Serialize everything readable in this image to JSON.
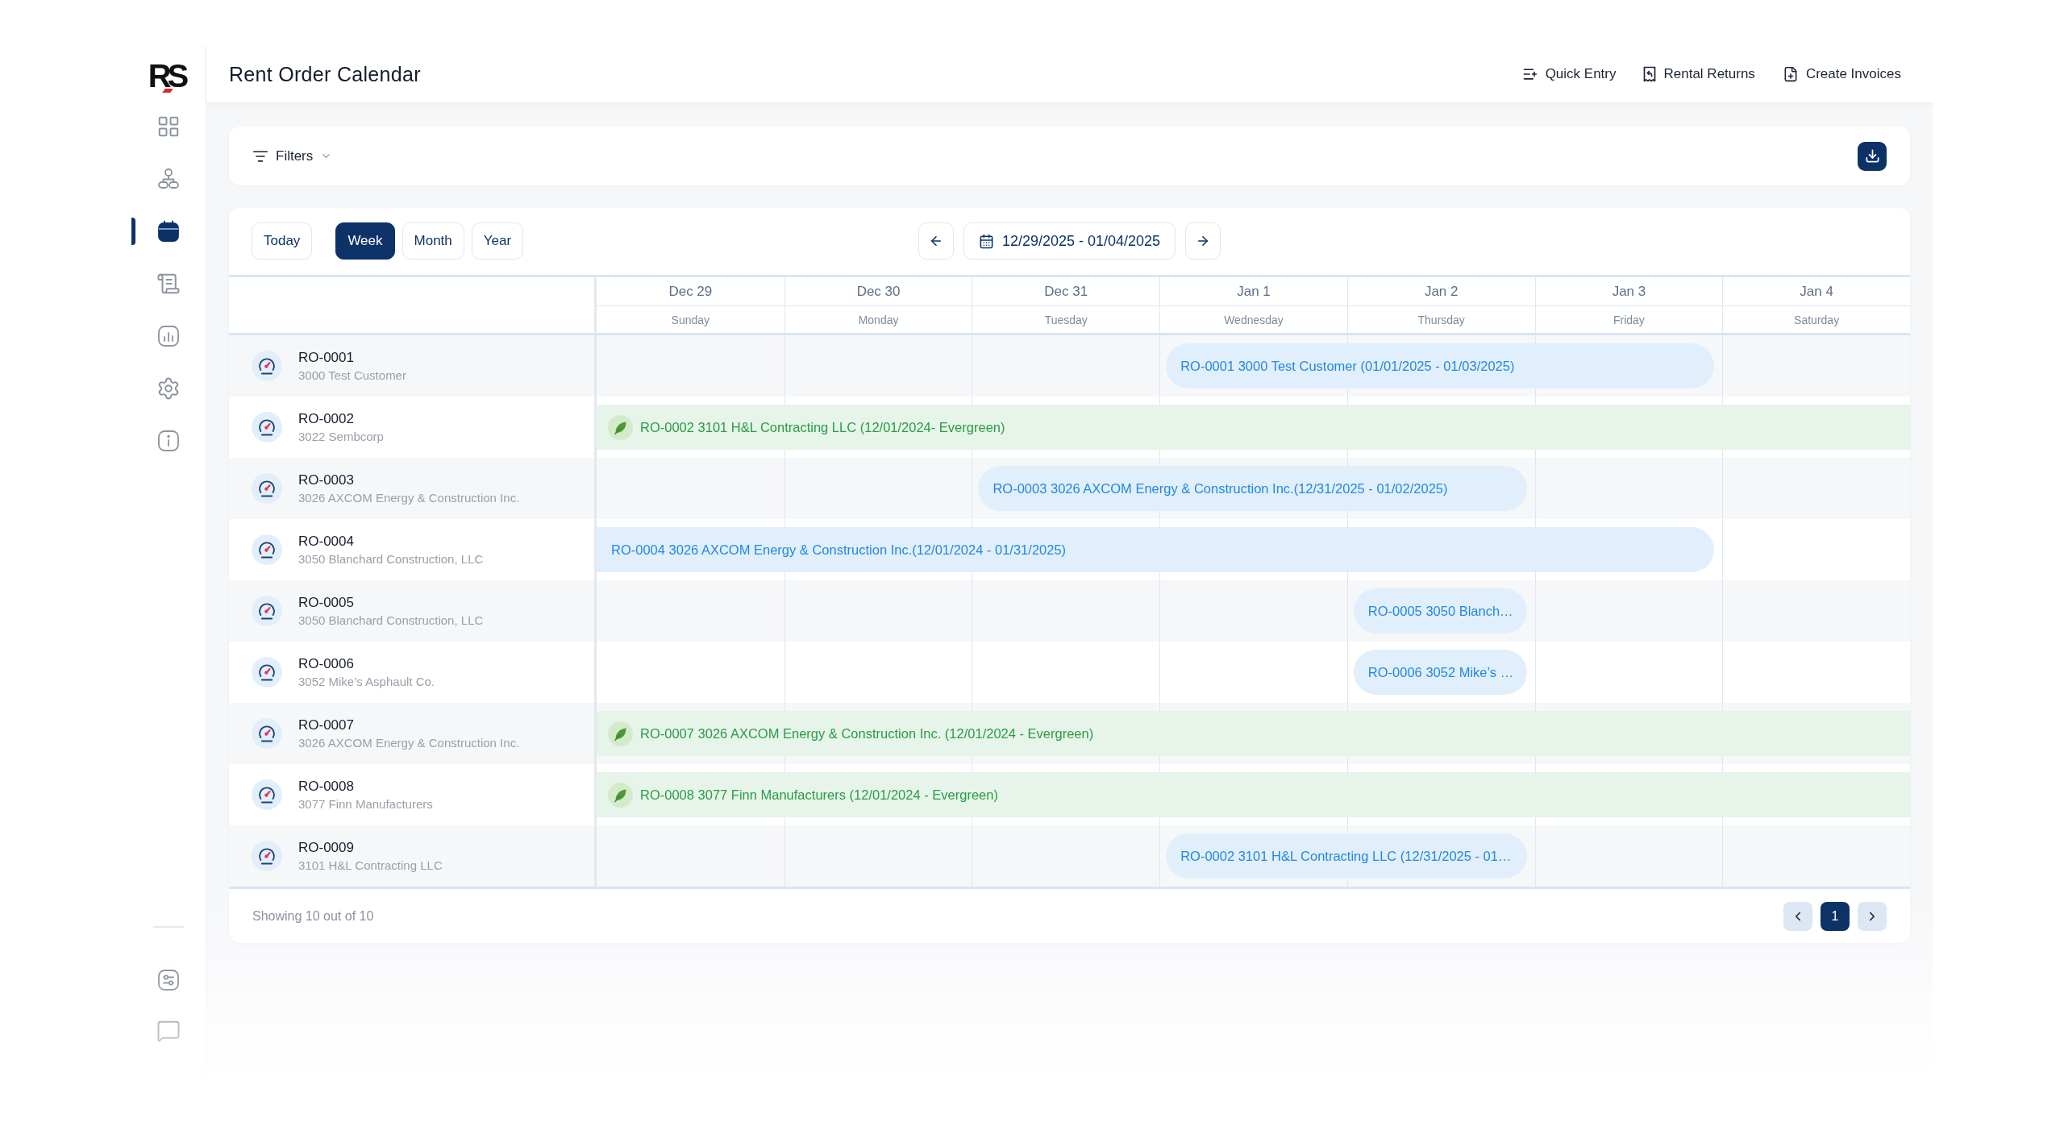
{
  "app": {
    "logo": "RS"
  },
  "sidebar": {
    "items": [
      {
        "selected": false
      },
      {
        "selected": false
      },
      {
        "selected": true
      },
      {
        "selected": false
      },
      {
        "selected": false
      },
      {
        "selected": false
      },
      {
        "selected": false
      }
    ],
    "bottom_items": [
      {
        "selected": false
      },
      {
        "selected": false
      }
    ]
  },
  "header": {
    "title": "Rent Order Calendar",
    "actions": [
      {
        "label": "Quick Entry"
      },
      {
        "label": "Rental Returns"
      },
      {
        "label": "Create Invoices"
      }
    ]
  },
  "filters": {
    "label": "Filters"
  },
  "toolbar": {
    "today": "Today",
    "views": [
      {
        "label": "Week",
        "selected": true
      },
      {
        "label": "Month",
        "selected": false
      },
      {
        "label": "Year",
        "selected": false
      }
    ],
    "date_range": "12/29/2025 - 01/04/2025"
  },
  "calendar": {
    "days": [
      {
        "date": "Dec 29",
        "weekday": "Sunday"
      },
      {
        "date": "Dec 30",
        "weekday": "Monday"
      },
      {
        "date": "Dec 31",
        "weekday": "Tuesday"
      },
      {
        "date": "Jan 1",
        "weekday": "Wednesday"
      },
      {
        "date": "Jan 2",
        "weekday": "Thursday"
      },
      {
        "date": "Jan 3",
        "weekday": "Friday"
      },
      {
        "date": "Jan 4",
        "weekday": "Saturday"
      }
    ],
    "rows": [
      {
        "order": "RO-0001",
        "customer": "3000 Test Customer",
        "booking": {
          "kind": "rental",
          "label": "RO-0001 3000 Test Customer (01/01/2025 - 01/03/2025)",
          "days": [
            {
              "kind": "free"
            },
            {
              "kind": "free"
            },
            {
              "kind": "free"
            },
            {
              "kind": "booked"
            },
            {
              "kind": "booked"
            },
            {
              "kind": "booked"
            },
            {
              "kind": "free"
            }
          ]
        }
      },
      {
        "order": "RO-0002",
        "customer": "3022 Sembcorp",
        "booking": {
          "kind": "evergreen",
          "label": "RO-0002 3101 H&L Contracting LLC (12/01/2024- Evergreen)",
          "days": [
            {
              "kind": "booked"
            },
            {
              "kind": "booked"
            },
            {
              "kind": "booked"
            },
            {
              "kind": "booked"
            },
            {
              "kind": "booked"
            },
            {
              "kind": "booked"
            },
            {
              "kind": "booked"
            }
          ]
        }
      },
      {
        "order": "RO-0003",
        "customer": "3026 AXCOM Energy & Construction Inc.",
        "booking": {
          "kind": "rental",
          "label": "RO-0003 3026 AXCOM Energy & Construction Inc.(12/31/2025 - 01/02/2025)",
          "days": [
            {
              "kind": "free"
            },
            {
              "kind": "free"
            },
            {
              "kind": "booked"
            },
            {
              "kind": "booked"
            },
            {
              "kind": "booked"
            },
            {
              "kind": "free"
            },
            {
              "kind": "free"
            }
          ]
        }
      },
      {
        "order": "RO-0004",
        "customer": "3050 Blanchard Construction, LLC",
        "booking": {
          "kind": "rental",
          "label": "RO-0004 3026 AXCOM Energy & Construction Inc.(12/01/2024 - 01/31/2025)",
          "days": [
            {
              "kind": "booked"
            },
            {
              "kind": "booked"
            },
            {
              "kind": "booked"
            },
            {
              "kind": "booked"
            },
            {
              "kind": "booked"
            },
            {
              "kind": "booked"
            },
            {
              "kind": "free"
            }
          ]
        }
      },
      {
        "order": "RO-0005",
        "customer": "3050 Blanchard Construction, LLC",
        "booking": {
          "kind": "rental",
          "label": "RO-0005 3050 Blanch…",
          "days": [
            {
              "kind": "free"
            },
            {
              "kind": "free"
            },
            {
              "kind": "free"
            },
            {
              "kind": "free"
            },
            {
              "kind": "booked"
            },
            {
              "kind": "free"
            },
            {
              "kind": "free"
            }
          ]
        }
      },
      {
        "order": "RO-0006",
        "customer": "3052 Mike’s Asphault Co.",
        "booking": {
          "kind": "rental",
          "label": "RO-0006 3052 Mike’s …",
          "days": [
            {
              "kind": "free"
            },
            {
              "kind": "free"
            },
            {
              "kind": "free"
            },
            {
              "kind": "free"
            },
            {
              "kind": "booked"
            },
            {
              "kind": "free"
            },
            {
              "kind": "free"
            }
          ]
        }
      },
      {
        "order": "RO-0007",
        "customer": "3026 AXCOM Energy & Construction Inc.",
        "booking": {
          "kind": "evergreen",
          "label": "RO-0007 3026 AXCOM Energy & Construction Inc. (12/01/2024 - Evergreen)",
          "days": [
            {
              "kind": "booked"
            },
            {
              "kind": "booked"
            },
            {
              "kind": "booked"
            },
            {
              "kind": "booked"
            },
            {
              "kind": "booked"
            },
            {
              "kind": "booked"
            },
            {
              "kind": "booked"
            }
          ]
        }
      },
      {
        "order": "RO-0008",
        "customer": "3077 Finn Manufacturers",
        "booking": {
          "kind": "evergreen",
          "label": "RO-0008 3077 Finn Manufacturers (12/01/2024 - Evergreen)",
          "days": [
            {
              "kind": "booked"
            },
            {
              "kind": "booked"
            },
            {
              "kind": "booked"
            },
            {
              "kind": "booked"
            },
            {
              "kind": "booked"
            },
            {
              "kind": "booked"
            },
            {
              "kind": "booked"
            }
          ]
        }
      },
      {
        "order": "RO-0009",
        "customer": "3101 H&L Contracting LLC",
        "booking": {
          "kind": "rental",
          "label": "RO-0002 3101 H&L Contracting LLC (12/31/2025 - 01…",
          "days": [
            {
              "kind": "free"
            },
            {
              "kind": "free"
            },
            {
              "kind": "free"
            },
            {
              "kind": "booked"
            },
            {
              "kind": "booked"
            },
            {
              "kind": "free"
            },
            {
              "kind": "free"
            }
          ]
        }
      }
    ]
  },
  "footer": {
    "summary": "Showing 10 out of 10",
    "pages": [
      {
        "label": "1",
        "selected": true
      }
    ]
  }
}
